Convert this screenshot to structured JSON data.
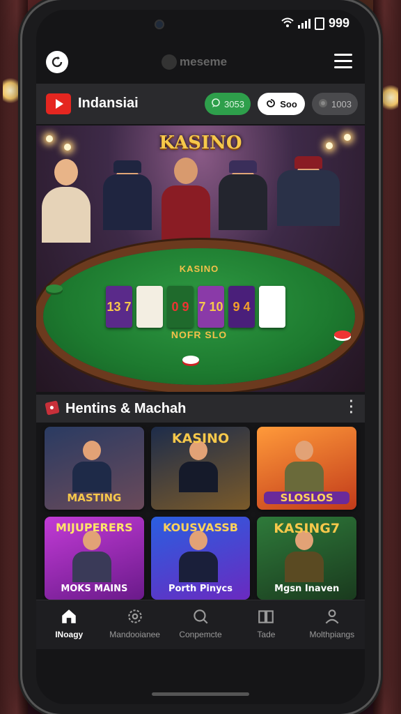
{
  "status_bar": {
    "battery": "999"
  },
  "topbar": {
    "brand": "meseme"
  },
  "app_header": {
    "title": "Indansiai",
    "chips": [
      {
        "label": "3053",
        "icon": "chat-bubble-icon"
      },
      {
        "label": "Soo",
        "icon": "swirl-icon"
      },
      {
        "label": "1003",
        "icon": "coin-icon"
      }
    ]
  },
  "banner": {
    "logo": "KASINO",
    "felt_top": "KASINO",
    "felt_bottom": "NOFR SLO",
    "cards": [
      "13 7",
      "",
      "0 9",
      "7 10",
      "9 4",
      ""
    ]
  },
  "section": {
    "title": "Hentins & Machah",
    "icon": "dice-icon"
  },
  "games": [
    {
      "title": "",
      "subtitle": "MASTING",
      "bg": [
        "#2a3b62",
        "#6a4a5a"
      ]
    },
    {
      "title": "KASINO",
      "subtitle": "",
      "bg": [
        "#1d2c4a",
        "#7a5a2a"
      ]
    },
    {
      "title": "",
      "subtitle": "SLOSLOS",
      "bg": [
        "#ff9a3a",
        "#c13a1a"
      ]
    },
    {
      "title": "MIJUPERERS",
      "subtitle": "MOKS MAINS",
      "bg": [
        "#c23bd6",
        "#6a1a8a"
      ]
    },
    {
      "title": "KOUSVASSB",
      "subtitle": "Porth Pinycs",
      "bg": [
        "#2a5fe0",
        "#6a2ac0"
      ]
    },
    {
      "title": "KASING7",
      "subtitle": "Mgsn Inaven",
      "bg": [
        "#2e7a3a",
        "#1a3a1e"
      ]
    }
  ],
  "nav": [
    {
      "label": "INoagy",
      "icon": "home-icon",
      "active": true
    },
    {
      "label": "Mandooianee",
      "icon": "gear-icon",
      "active": false
    },
    {
      "label": "Conpemcte",
      "icon": "search-icon",
      "active": false
    },
    {
      "label": "Tade",
      "icon": "book-icon",
      "active": false
    },
    {
      "label": "Molthpiangs",
      "icon": "user-icon",
      "active": false
    }
  ],
  "colors": {
    "accent_green": "#2e9f4b",
    "youtube_red": "#e52620",
    "gold": "#f6c84b",
    "felt": "#1d7a2f"
  }
}
